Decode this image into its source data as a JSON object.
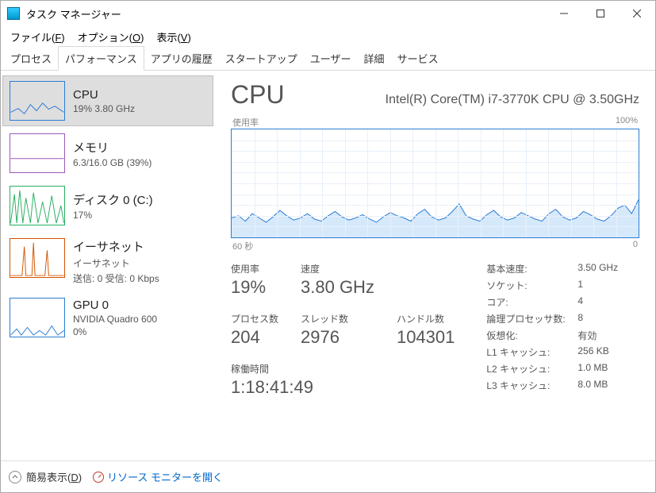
{
  "window": {
    "title": "タスク マネージャー"
  },
  "menu": {
    "file": "ファイル(F)",
    "options": "オプション(O)",
    "view": "表示(V)"
  },
  "tabs": [
    "プロセス",
    "パフォーマンス",
    "アプリの履歴",
    "スタートアップ",
    "ユーザー",
    "詳細",
    "サービス"
  ],
  "active_tab": 1,
  "sidebar": [
    {
      "title": "CPU",
      "sub": "19% 3.80 GHz",
      "kind": "cpu"
    },
    {
      "title": "メモリ",
      "sub": "6.3/16.0 GB (39%)",
      "kind": "mem"
    },
    {
      "title": "ディスク 0 (C:)",
      "sub": "17%",
      "kind": "disk"
    },
    {
      "title": "イーサネット",
      "sub": "イーサネット",
      "sub2": "送信: 0 受信: 0 Kbps",
      "kind": "eth"
    },
    {
      "title": "GPU 0",
      "sub": "NVIDIA Quadro 600",
      "sub2": "0%",
      "kind": "gpu"
    }
  ],
  "selected_side": 0,
  "detail": {
    "title": "CPU",
    "model": "Intel(R) Core(TM) i7-3770K CPU @ 3.50GHz",
    "chart_top_left": "使用率",
    "chart_top_right": "100%",
    "chart_bot_left": "60 秒",
    "chart_bot_right": "0",
    "stats": {
      "util_label": "使用率",
      "util": "19%",
      "speed_label": "速度",
      "speed": "3.80 GHz",
      "proc_label": "プロセス数",
      "proc": "204",
      "thr_label": "スレッド数",
      "thr": "2976",
      "hnd_label": "ハンドル数",
      "hnd": "104301",
      "up_label": "稼働時間",
      "up": "1:18:41:49"
    },
    "right": [
      {
        "k": "基本速度:",
        "v": "3.50 GHz"
      },
      {
        "k": "ソケット:",
        "v": "1"
      },
      {
        "k": "コア:",
        "v": "4"
      },
      {
        "k": "論理プロセッサ数:",
        "v": "8"
      },
      {
        "k": "仮想化:",
        "v": "有効"
      },
      {
        "k": "L1 キャッシュ:",
        "v": "256 KB"
      },
      {
        "k": "L2 キャッシュ:",
        "v": "1.0 MB"
      },
      {
        "k": "L3 キャッシュ:",
        "v": "8.0 MB"
      }
    ]
  },
  "footer": {
    "fewer": "簡易表示(D)",
    "resmon": "リソース モニターを開く"
  },
  "chart_data": {
    "type": "area",
    "title": "CPU 使用率",
    "ylabel": "%",
    "ylim": [
      0,
      100
    ],
    "xlabel": "秒",
    "xlim": [
      60,
      0
    ],
    "values": [
      18,
      20,
      15,
      22,
      18,
      14,
      19,
      25,
      20,
      16,
      18,
      22,
      17,
      15,
      20,
      24,
      19,
      16,
      18,
      21,
      17,
      14,
      19,
      23,
      20,
      18,
      15,
      22,
      26,
      19,
      16,
      18,
      24,
      31,
      20,
      17,
      15,
      21,
      25,
      19,
      16,
      18,
      23,
      20,
      17,
      15,
      22,
      26,
      19,
      16,
      18,
      24,
      21,
      17,
      15,
      20,
      27,
      30,
      22,
      35
    ]
  }
}
